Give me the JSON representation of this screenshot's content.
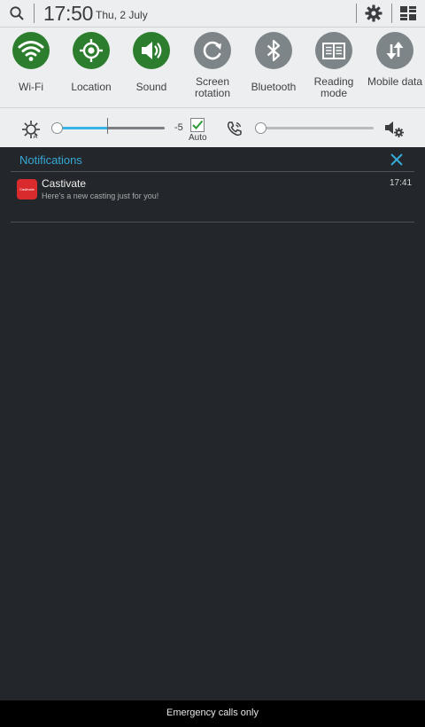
{
  "status_bar": {
    "time": "17:50",
    "date": "Thu, 2 July"
  },
  "quick_settings": [
    {
      "label": "Wi-Fi",
      "icon": "wifi-icon",
      "state": "on"
    },
    {
      "label": "Location",
      "icon": "location-icon",
      "state": "on"
    },
    {
      "label": "Sound",
      "icon": "sound-icon",
      "state": "on"
    },
    {
      "label": "Screen rotation",
      "icon": "rotation-icon",
      "state": "off"
    },
    {
      "label": "Bluetooth",
      "icon": "bluetooth-icon",
      "state": "off"
    },
    {
      "label": "Reading mode",
      "icon": "book-icon",
      "state": "off"
    },
    {
      "label": "Mobile data",
      "icon": "mobile-data-icon",
      "state": "off"
    }
  ],
  "brightness": {
    "value_label": "-5",
    "auto_label": "Auto",
    "auto_checked": true,
    "level": 0.05
  },
  "volume": {
    "level": 0.03
  },
  "notifications": {
    "header": "Notifications",
    "items": [
      {
        "app": "Castivate",
        "icon_text": "Castivate",
        "text": "Here's a new casting just for you!",
        "time": "17:41"
      }
    ]
  },
  "bottom_bar": {
    "text": "Emergency calls only"
  },
  "colors": {
    "accent": "#35a9d6",
    "toggle_on": "#2c7d2e",
    "toggle_off": "#7e8589",
    "app_icon": "#d92b2e"
  }
}
